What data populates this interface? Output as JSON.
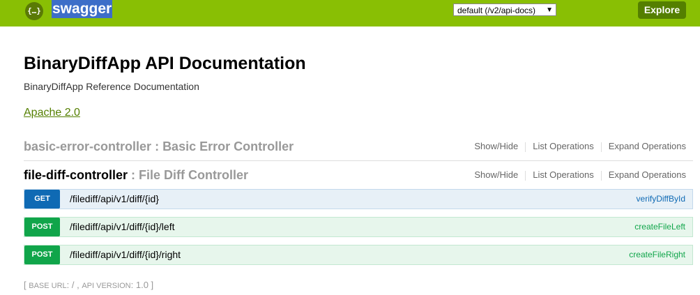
{
  "header": {
    "logo_glyph": "{…}",
    "logo_text": "swagger",
    "api_select_value": "default (/v2/api-docs)",
    "explore_label": "Explore",
    "colors": {
      "bar": "#89bf04",
      "explore": "#547f00"
    }
  },
  "info": {
    "title": "BinaryDiffApp API Documentation",
    "description": "BinaryDiffApp Reference Documentation",
    "license": "Apache 2.0"
  },
  "controllers": [
    {
      "name": "basic-error-controller",
      "separator": " : ",
      "description": "Basic Error Controller",
      "actions": [
        "Show/Hide",
        "List Operations",
        "Expand Operations"
      ]
    },
    {
      "name": "file-diff-controller",
      "separator": " : ",
      "description": "File Diff Controller",
      "actions": [
        "Show/Hide",
        "List Operations",
        "Expand Operations"
      ]
    }
  ],
  "operations": [
    {
      "method": "GET",
      "path": "/filediff/api/v1/diff/{id}",
      "operation_id": "verifyDiffById"
    },
    {
      "method": "POST",
      "path": "/filediff/api/v1/diff/{id}/left",
      "operation_id": "createFileLeft"
    },
    {
      "method": "POST",
      "path": "/filediff/api/v1/diff/{id}/right",
      "operation_id": "createFileRight"
    }
  ],
  "footer": {
    "open": "[ ",
    "base_url_label": "BASE URL",
    "base_url_value": ": / , ",
    "api_version_label": "API VERSION",
    "api_version_value": ": 1.0 ",
    "close": "]"
  }
}
